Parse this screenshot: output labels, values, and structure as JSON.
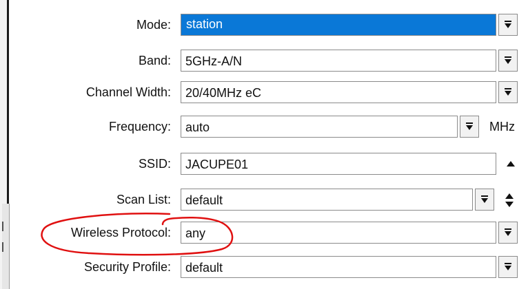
{
  "form": {
    "mode": {
      "label": "Mode:",
      "value": "station"
    },
    "band": {
      "label": "Band:",
      "value": "5GHz-A/N"
    },
    "channel_width": {
      "label": "Channel Width:",
      "value": "20/40MHz eC"
    },
    "frequency": {
      "label": "Frequency:",
      "value": "auto",
      "unit": "MHz"
    },
    "ssid": {
      "label": "SSID:",
      "value": "JACUPE01"
    },
    "scan_list": {
      "label": "Scan List:",
      "value": "default"
    },
    "wireless_protocol": {
      "label": "Wireless Protocol:",
      "value": "any"
    },
    "security_profile": {
      "label": "Security Profile:",
      "value": "default"
    }
  },
  "icons": {
    "dropdown": "dropdown-arrow-icon",
    "collapse": "triangle-up-icon",
    "up_down": "up-down-arrows-icon"
  },
  "colors": {
    "selection": "#0a78d7",
    "annotation": "#e01010"
  }
}
